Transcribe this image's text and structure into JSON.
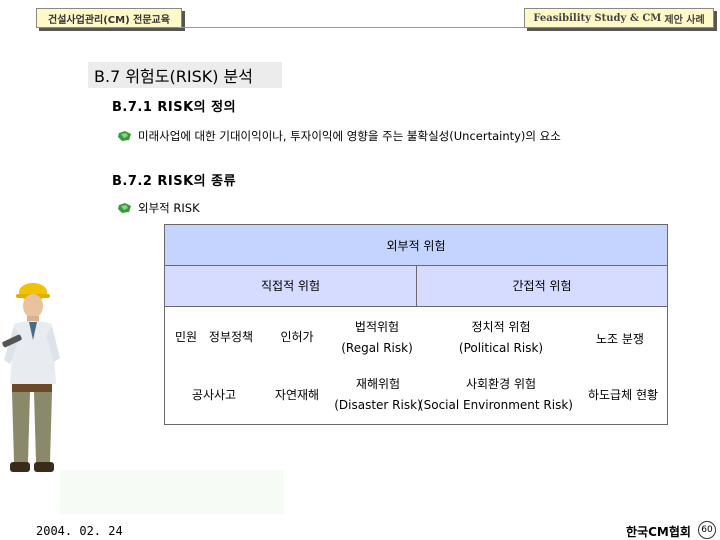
{
  "header": {
    "left_tab": "건설사업관리(CM) 전문교육",
    "right_tab_en": "Feasibility Study & CM",
    "right_tab_kr": "제안 사례"
  },
  "section": {
    "title": "B.7 위험도(RISK) 분석",
    "sub1": "B.7.1  RISK의 정의",
    "bullet1": "미래사업에 대한 기대이익이나, 투자이익에 영향을 주는 불확실성(Uncertainty)의 요소",
    "sub2": "B.7.2  RISK의 종류",
    "bullet2": "외부적 RISK"
  },
  "table": {
    "top": "외부적 위험",
    "direct": "직접적 위험",
    "indirect": "간접적 위험",
    "cells": {
      "civil": "민원",
      "policy": "정부정책",
      "permit": "인허가",
      "legal_kr": "법적위험",
      "legal_en": "(Regal Risk)",
      "political_kr": "정치적 위험",
      "political_en": "(Political Risk)",
      "labor": "노조 분쟁",
      "accident": "공사사고",
      "natural": "자연재해",
      "disaster_kr": "재해위험",
      "disaster_en": "(Disaster Risk)",
      "social_kr": "사회환경 위험",
      "social_en": "(Social Environment Risk)",
      "subcontract": "하도급체 현황"
    }
  },
  "footer": {
    "date": "2004. 02. 24",
    "org": "한국CM협회",
    "page": "60"
  },
  "colors": {
    "table_top": "#c5d3ff",
    "table_mid": "#d5dcff",
    "tab_bg": "#fff9c8"
  }
}
